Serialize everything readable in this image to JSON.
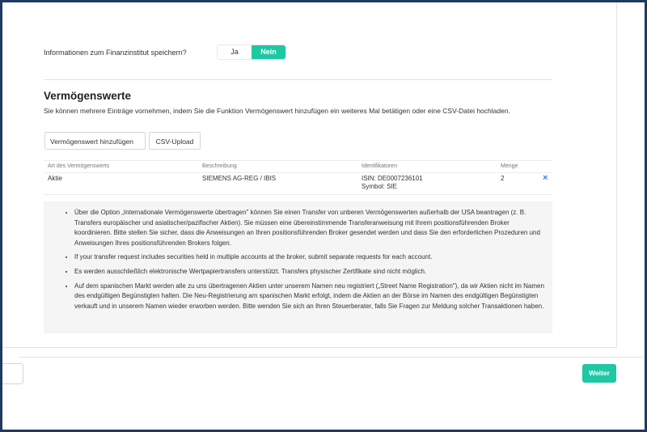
{
  "save_question": {
    "label": "Informationen zum Finanzinstitut speichern?",
    "options": [
      "Ja",
      "Nein"
    ],
    "selected": "Nein"
  },
  "assets": {
    "title": "Vermögenswerte",
    "description": "Sie können mehrere Einträge vornehmen, indem Sie die Funktion Vermögenswert hinzufügen ein weiteres Mal betätigen oder eine CSV-Datei hochladen.",
    "add_button": "Vermögenswert hinzufügen",
    "csv_button": "CSV-Upload",
    "table": {
      "headers": [
        "Art des Vermögenswerts",
        "Beschreibung",
        "Identifikatoren",
        "Menge"
      ],
      "rows": [
        {
          "type": "Aktie",
          "description": "SIEMENS AG-REG / IBIS",
          "isin": "ISIN: DE0007236101",
          "symbol": "Symbol: SIE",
          "quantity": "2",
          "remove": "×"
        }
      ]
    }
  },
  "notes": [
    "Über die Option „Internationale Vermögenswerte übertragen\" können Sie einen Transfer von unberen Vermögenswerten außerhalb der USA beantragen (z. B. Transfers europäischer und asiatischer/pazifischer Aktien). Sie müssen eine übereinstimmende Transferanweisung mit Ihrem positionsführenden Broker koordinieren. Bitte stellen Sie sicher, dass die Anweisungen an Ihren positionsführenden Broker gesendet werden und dass Sie den erforderlichen Prozeduren und Anweisungen Ihres positionsführenden Brokers folgen.",
    "If your transfer request includes securities held in multiple accounts at the broker, submit separate requests for each account.",
    "Es werden ausschließlich elektronische Wertpapiertransfers unterstützt. Transfers physischer Zertifikate sind nicht möglich.",
    "Auf dem spanischen Markt werden alle zu uns übertragenen Aktien unter unserem Namen neu registriert („Street Name Registration\"), da wir Aktien nicht im Namen des endgültigen Begünstigten halten. Die Neu-Registrierung am spanischen Markt erfolgt, indem die Aktien an der Börse im Namen des endgültigen Begünstigten verkauft und in unserem Namen wieder erworben werden. Bitte wenden Sie sich an Ihren Steuerberater, falls Sie Fragen zur Meldung solcher Transaktionen haben."
  ],
  "footer": {
    "next_button": "Weiter"
  },
  "colors": {
    "accent": "#1ec8a2",
    "remove_icon": "#3b7dd8"
  }
}
